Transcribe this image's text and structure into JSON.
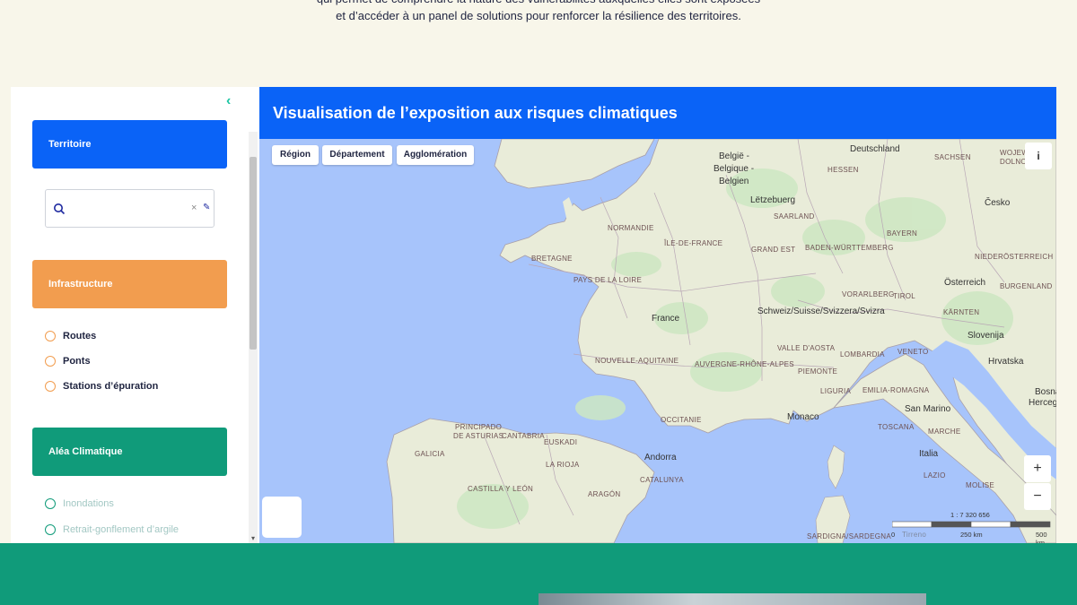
{
  "intro": {
    "line1": "qui permet de comprendre la nature des vulnérabilités auxquelles elles sont exposées",
    "line2": "et d’accéder à un panel de solutions pour renforcer la résilience des territoires."
  },
  "panel": {
    "collapse_icon": "chevron-left-icon",
    "territoire_label": "Territoire",
    "search": {
      "value": "",
      "placeholder": ""
    },
    "infrastructure_label": "Infrastructure",
    "infrastructure_options": [
      "Routes",
      "Ponts",
      "Stations d’épuration"
    ],
    "alea_label": "Aléa Climatique",
    "alea_options": [
      "Inondations",
      "Retrait-gonflement d’argile"
    ],
    "colors": {
      "territoire": "#0a63f7",
      "infrastructure": "#f29d4f",
      "alea": "#109b7a"
    }
  },
  "map": {
    "title": "Visualisation de l’exposition aux risques climatiques",
    "tabs": [
      "Région",
      "Département",
      "Agglomération"
    ],
    "info_label": "i",
    "zoom_in": "+",
    "zoom_out": "−",
    "scale_ratio": "1 : 7 320 656",
    "scale_labels": [
      "0",
      "250 km",
      "500 km"
    ],
    "labels": {
      "deutschland": "Deutschland",
      "belgique_1": "België -",
      "belgique_2": "Belgique -",
      "belgique_3": "Belgien",
      "letzebuerg": "Lëtzebuerg",
      "hessen": "HESSEN",
      "sachsen": "SACHSEN",
      "wojew_1": "WOJEW",
      "wojew_2": "DOLNOS",
      "saarland": "SAARLAND",
      "cesko": "Česko",
      "normandie": "NORMANDIE",
      "idf": "ÎLE-DE-FRANCE",
      "grand_est": "GRAND EST",
      "bw": "BADEN-WÜRTTEMBERG",
      "bayern": "BAYERN",
      "bretagne": "BRETAGNE",
      "niederoesterreich": "NIEDERÖSTERREICH",
      "pdl": "PAYS DE LA LOIRE",
      "oesterreich": "Österreich",
      "vorarlberg": "VORARLBERG",
      "tirol": "TIROL",
      "burgenland": "BURGENLAND",
      "france": "France",
      "schweiz": "Schweiz/Suisse/Svizzera/Svizra",
      "kaernten": "KÄRNTEN",
      "valle_aosta": "VALLE D'AOSTA",
      "slovenija": "Slovenija",
      "lombardia": "LOMBARDIA",
      "veneto": "VENETO",
      "nouvelle_aquitaine": "NOUVELLE-AQUITAINE",
      "aura": "AUVERGNE-RHÔNE-ALPES",
      "piemonte": "PIEMONTE",
      "hrvatska": "Hrvatska",
      "liguria": "LIGURIA",
      "emilia": "EMILIA-ROMAGNA",
      "bosna_1": "Bosna",
      "bosna_2": "Hercegov",
      "asturias_1": "PRINCIPADO",
      "asturias_2": "DE ASTURIAS",
      "cantabria": "CANTABRIA",
      "occitanie": "OCCITANIE",
      "monaco": "Monaco",
      "san_marino": "San Marino",
      "euskadi": "EUSKADI",
      "toscana": "TOSCANA",
      "marche": "MARCHE",
      "galicia": "GALICIA",
      "la_rioja": "LA RIOJA",
      "andorra": "Andorra",
      "italia": "Italia",
      "catalunya": "CATALUNYA",
      "lazio": "LAZIO",
      "castilla": "CASTILLA Y LEÓN",
      "aragon": "ARAGÓN",
      "molise": "MOLISE",
      "sardigna": "SARDIGNA/SARDEGNA",
      "tirreno": "Tirreno"
    }
  }
}
